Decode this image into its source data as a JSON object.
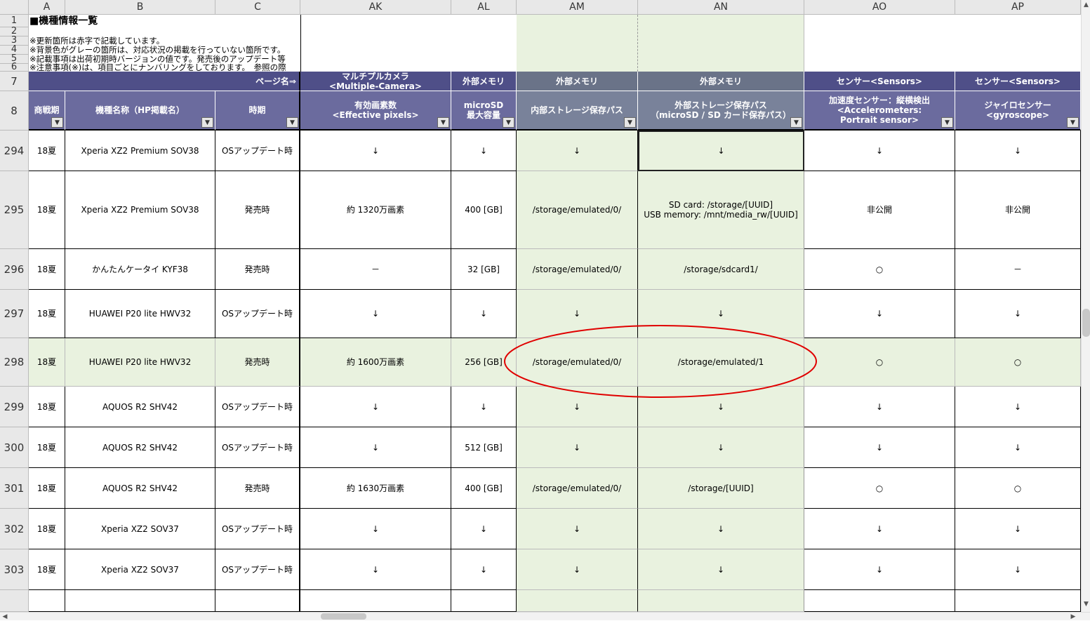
{
  "columns": [
    {
      "letter": "",
      "header": ""
    },
    {
      "letter": "A"
    },
    {
      "letter": "B"
    },
    {
      "letter": "C"
    },
    {
      "letter": "AK"
    },
    {
      "letter": "AL"
    },
    {
      "letter": "AM"
    },
    {
      "letter": "AN"
    },
    {
      "letter": "AO"
    },
    {
      "letter": "AP"
    }
  ],
  "sheet_title": "■機種情報一覧",
  "notes": [
    "※更新箇所は赤字で記載しています。",
    "※背景色がグレーの箇所は、対応状況の掲載を行っていない箇所です。",
    "※記載事項は出荷初期時バージョンの値です。発売後のアップデート等",
    "※注意事項(※)は、項目ごとにナンバリングをしております。　参照の際"
  ],
  "small_row_numbers": [
    "1",
    "2",
    "3",
    "4",
    "5",
    "6"
  ],
  "header_row7": {
    "row_num": "7",
    "page_name": "ページ名⇒",
    "AK": "マルチプルカメラ\n<Multiple-Camera>",
    "AL": "外部メモリ",
    "AM": "外部メモリ",
    "AN": "外部メモリ",
    "AO": "センサー<Sensors>",
    "AP": "センサー<Sensors>"
  },
  "header_row8": {
    "row_num": "8",
    "A": "商戦期",
    "B": "機種名称（HP掲載名）",
    "C": "時期",
    "AK": "有効画素数\n<Effective pixels>",
    "AL": "microSD\n最大容量",
    "AM": "内部ストレージ保存パス",
    "AN": "外部ストレージ保存パス\n（microSD / SD カード保存パス）",
    "AO": "加速度センサー：縦横検出\n<Accelerometers:\nPortrait sensor>",
    "AP": "ジャイロセンサー\n<gyroscope>"
  },
  "filter_icon": "dropdown-filter-icon",
  "rows": [
    {
      "num": "294",
      "A": "18夏",
      "B": "Xperia XZ2 Premium SOV38",
      "C": "OSアップデート時",
      "AK": "↓",
      "AL": "↓",
      "AM": "↓",
      "AN": "↓",
      "AO": "↓",
      "AP": "↓"
    },
    {
      "num": "295",
      "A": "18夏",
      "B": "Xperia XZ2 Premium SOV38",
      "C": "発売時",
      "AK": "約 1320万画素",
      "AL": "400 [GB]",
      "AM": "/storage/emulated/0/",
      "AN": "SD card: /storage/[UUID]\nUSB memory: /mnt/media_rw/[UUID]",
      "AO": "非公開",
      "AP": "非公開"
    },
    {
      "num": "296",
      "A": "18夏",
      "B": "かんたんケータイ KYF38",
      "C": "発売時",
      "AK": "－",
      "AL": "32 [GB]",
      "AM": "/storage/emulated/0/",
      "AN": "/storage/sdcard1/",
      "AO": "○",
      "AP": "－"
    },
    {
      "num": "297",
      "A": "18夏",
      "B": "HUAWEI P20 lite HWV32",
      "C": "OSアップデート時",
      "AK": "↓",
      "AL": "↓",
      "AM": "↓",
      "AN": "↓",
      "AO": "↓",
      "AP": "↓"
    },
    {
      "num": "298",
      "A": "18夏",
      "B": "HUAWEI P20 lite HWV32",
      "C": "発売時",
      "AK": "約 1600万画素",
      "AL": "256 [GB]",
      "AM": "/storage/emulated/0/",
      "AN": "/storage/emulated/1",
      "AO": "○",
      "AP": "○"
    },
    {
      "num": "299",
      "A": "18夏",
      "B": "AQUOS R2 SHV42",
      "C": "OSアップデート時",
      "AK": "↓",
      "AL": "↓",
      "AM": "↓",
      "AN": "↓",
      "AO": "↓",
      "AP": "↓"
    },
    {
      "num": "300",
      "A": "18夏",
      "B": "AQUOS R2 SHV42",
      "C": "OSアップデート時",
      "AK": "↓",
      "AL": "512 [GB]",
      "AM": "↓",
      "AN": "↓",
      "AO": "↓",
      "AP": "↓"
    },
    {
      "num": "301",
      "A": "18夏",
      "B": "AQUOS R2 SHV42",
      "C": "発売時",
      "AK": "約 1630万画素",
      "AL": "400 [GB]",
      "AM": "/storage/emulated/0/",
      "AN": "/storage/[UUID]",
      "AO": "○",
      "AP": "○"
    },
    {
      "num": "302",
      "A": "18夏",
      "B": "Xperia XZ2 SOV37",
      "C": "OSアップデート時",
      "AK": "↓",
      "AL": "↓",
      "AM": "↓",
      "AN": "↓",
      "AO": "↓",
      "AP": "↓"
    },
    {
      "num": "303",
      "A": "18夏",
      "B": "Xperia XZ2 SOV37",
      "C": "OSアップデート時",
      "AK": "↓",
      "AL": "↓",
      "AM": "↓",
      "AN": "↓",
      "AO": "↓",
      "AP": "↓"
    },
    {
      "num": "",
      "A": "",
      "B": "",
      "C": "",
      "AK": "",
      "AL": "",
      "AM": "",
      "AN": "",
      "AO": "",
      "AP": ""
    }
  ],
  "highlight_color": "#e9f2df",
  "annotation_color": "#e00000",
  "header_color": "#6b6b9e"
}
